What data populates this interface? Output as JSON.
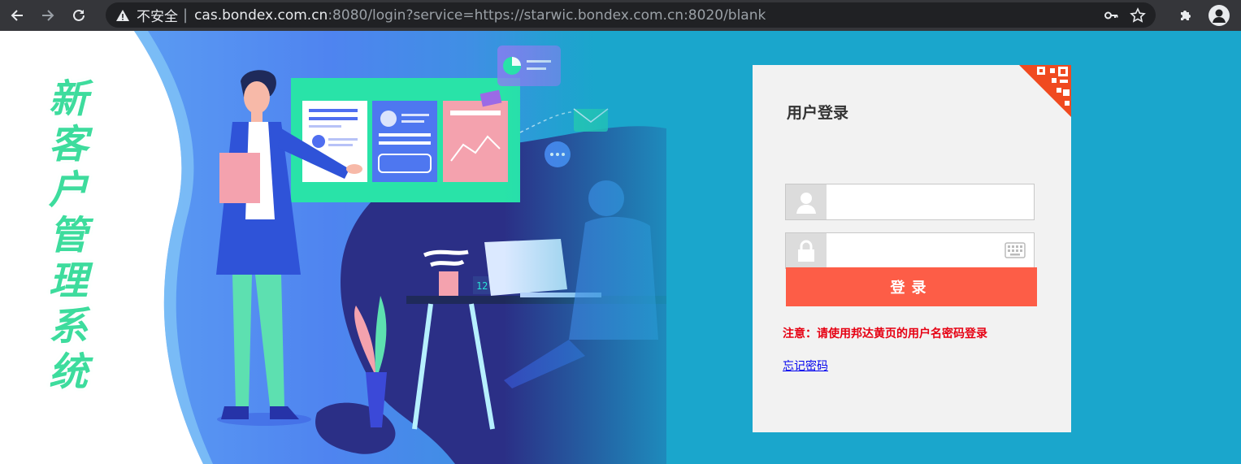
{
  "browser": {
    "security_label": "不安全",
    "separator": "|",
    "url_host": "cas.bondex.com.cn",
    "url_rest": ":8080/login?service=https://starwic.bondex.com.cn:8020/blank",
    "icons": [
      "back-icon",
      "forward-icon",
      "reload-icon",
      "warning-icon",
      "key-icon",
      "star-icon",
      "puzzle-icon",
      "profile-icon"
    ]
  },
  "banner": {
    "title_chars": [
      "新",
      "客",
      "户",
      "管",
      "理",
      "系",
      "统"
    ],
    "clock_text": "12:45"
  },
  "login": {
    "title": "用户登录",
    "username_placeholder": "",
    "password_placeholder": "",
    "submit_label": "登录",
    "notice": "注意：请使用邦达黄页的用户名密码登录",
    "forgot_link": "忘记密码"
  },
  "colors": {
    "accent_button": "#fd5d47",
    "notice_red": "#e60012",
    "page_blue": "#1aa6cc",
    "title_green": "#3ddc9d"
  }
}
